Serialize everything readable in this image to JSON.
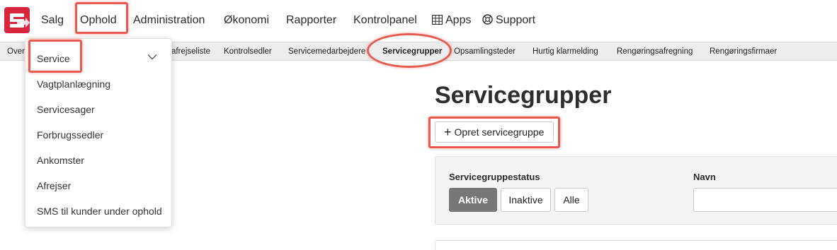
{
  "nav": {
    "items": [
      {
        "label": "Salg"
      },
      {
        "label": "Ophold"
      },
      {
        "label": "Administration"
      },
      {
        "label": "Økonomi"
      },
      {
        "label": "Rapporter"
      },
      {
        "label": "Kontrolpanel"
      },
      {
        "label": "Apps"
      },
      {
        "label": "Support"
      }
    ]
  },
  "subnav": {
    "items": [
      {
        "label": "Over"
      },
      {
        "label": "afrejseliste"
      },
      {
        "label": "Kontrolsedler"
      },
      {
        "label": "Servicemedarbejdere"
      },
      {
        "label": "Servicegrupper"
      },
      {
        "label": "Opsamlingsteder"
      },
      {
        "label": "Hurtig klarmelding"
      },
      {
        "label": "Rengøringsafregning"
      },
      {
        "label": "Rengøringsfirmaer"
      }
    ]
  },
  "dropdown": {
    "items": [
      {
        "label": "Service"
      },
      {
        "label": "Vagtplanlægning"
      },
      {
        "label": "Servicesager"
      },
      {
        "label": "Forbrugssedler"
      },
      {
        "label": "Ankomster"
      },
      {
        "label": "Afrejser"
      },
      {
        "label": "SMS til kunder under ophold"
      }
    ]
  },
  "main": {
    "title": "Servicegrupper",
    "create_button": "Opret servicegruppe",
    "filter": {
      "status_label": "Servicegruppestatus",
      "status_options": [
        {
          "label": "Aktive",
          "selected": true
        },
        {
          "label": "Inaktive",
          "selected": false
        },
        {
          "label": "Alle",
          "selected": false
        }
      ],
      "name_label": "Navn",
      "name_value": ""
    }
  },
  "colors": {
    "brand": "#d7263d",
    "highlight": "#e85a4f",
    "active_segment": "#777777"
  },
  "icons": {
    "apps": "grid-icon",
    "support": "lifebuoy-icon",
    "dropdown": "chevron-down-icon",
    "create": "plus-icon"
  }
}
